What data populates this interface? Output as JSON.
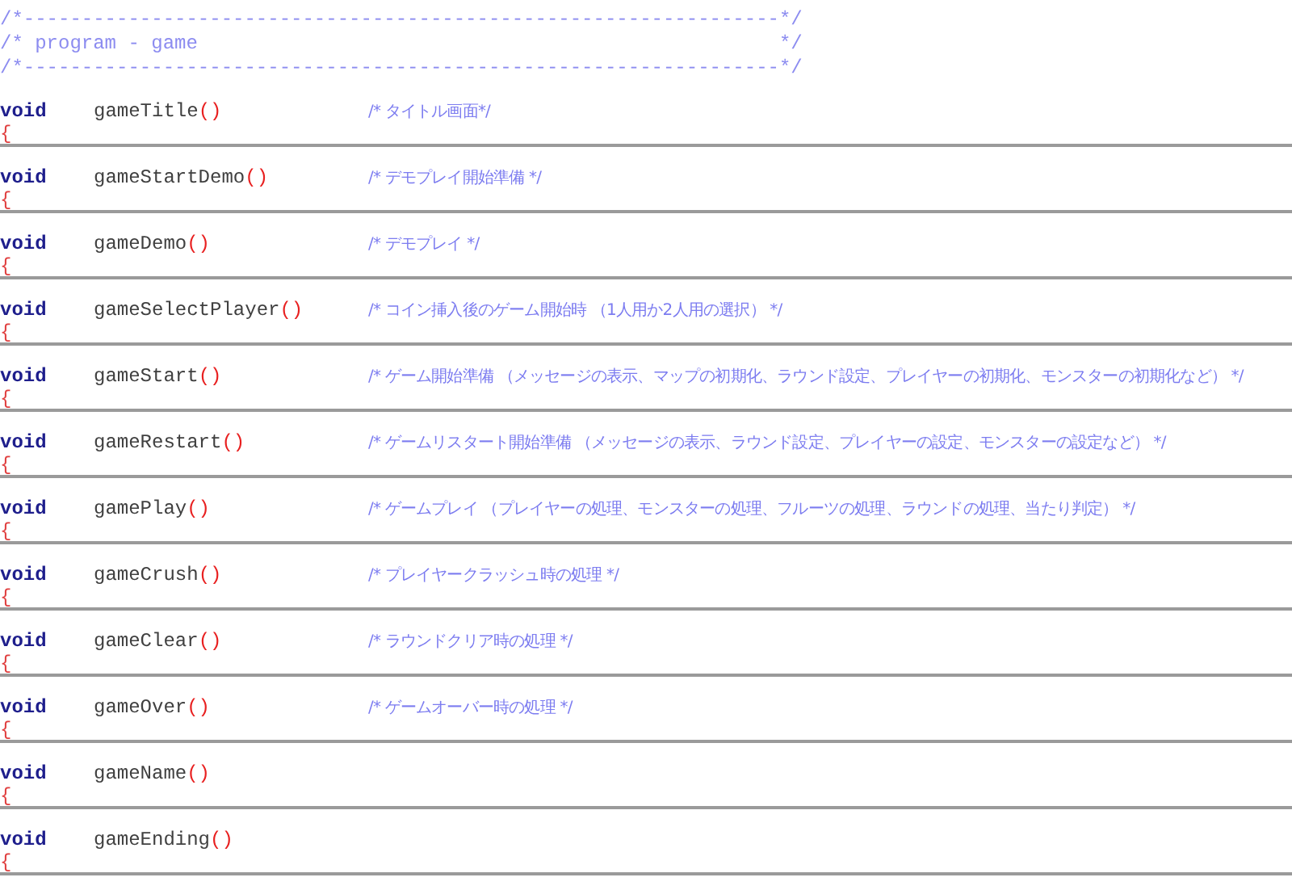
{
  "header_comment": [
    "/*-----------------------------------------------------------------*/",
    "/* program - game                                                  */",
    "/*-----------------------------------------------------------------*/"
  ],
  "functions": [
    {
      "keyword": "void",
      "name": "gameTitle",
      "parens": "()",
      "brace": "{",
      "comment": "/* タイトル画面*/"
    },
    {
      "keyword": "void",
      "name": "gameStartDemo",
      "parens": "()",
      "brace": "{",
      "comment": "/* デモプレイ開始準備 */"
    },
    {
      "keyword": "void",
      "name": "gameDemo",
      "parens": "()",
      "brace": "{",
      "comment": "/* デモプレイ */"
    },
    {
      "keyword": "void",
      "name": "gameSelectPlayer",
      "parens": "()",
      "brace": "{",
      "comment": "/* コイン挿入後のゲーム開始時 （1人用か2人用の選択） */"
    },
    {
      "keyword": "void",
      "name": "gameStart",
      "parens": "()",
      "brace": "{",
      "comment": "/* ゲーム開始準備 （メッセージの表示、マップの初期化、ラウンド設定、プレイヤーの初期化、モンスターの初期化など） */"
    },
    {
      "keyword": "void",
      "name": "gameRestart",
      "parens": "()",
      "brace": "{",
      "comment": "/* ゲームリスタート開始準備 （メッセージの表示、ラウンド設定、プレイヤーの設定、モンスターの設定など） */"
    },
    {
      "keyword": "void",
      "name": "gamePlay",
      "parens": "()",
      "brace": "{",
      "comment": "/* ゲームプレイ （プレイヤーの処理、モンスターの処理、フルーツの処理、ラウンドの処理、当たり判定） */"
    },
    {
      "keyword": "void",
      "name": "gameCrush",
      "parens": "()",
      "brace": "{",
      "comment": "/* プレイヤークラッシュ時の処理 */"
    },
    {
      "keyword": "void",
      "name": "gameClear",
      "parens": "()",
      "brace": "{",
      "comment": "/* ラウンドクリア時の処理 */"
    },
    {
      "keyword": "void",
      "name": "gameOver",
      "parens": "()",
      "brace": "{",
      "comment": "/* ゲームオーバー時の処理 */"
    },
    {
      "keyword": "void",
      "name": "gameName",
      "parens": "()",
      "brace": "{"
    },
    {
      "keyword": "void",
      "name": "gameEnding",
      "parens": "()",
      "brace": "{"
    }
  ]
}
